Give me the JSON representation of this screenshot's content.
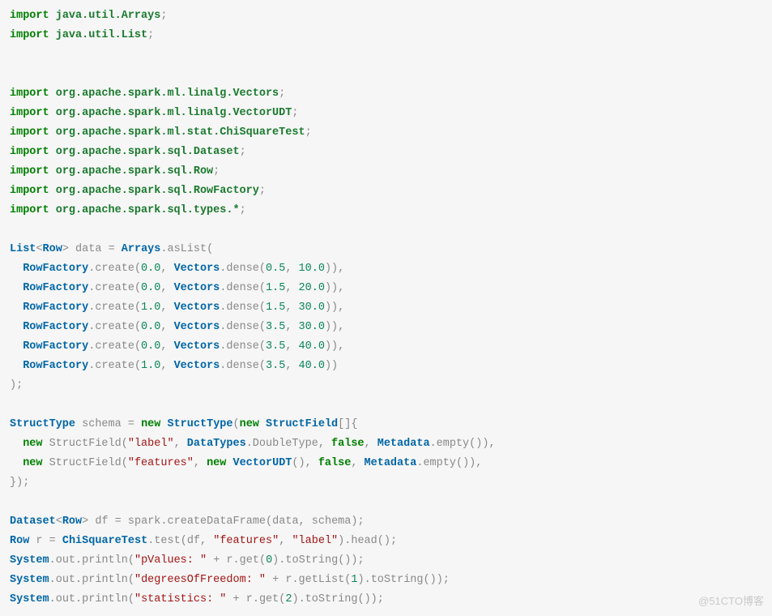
{
  "watermark": "@51CTO博客",
  "imports": [
    "java.util.Arrays",
    "java.util.List",
    "",
    "org.apache.spark.ml.linalg.Vectors",
    "org.apache.spark.ml.linalg.VectorUDT",
    "org.apache.spark.ml.stat.ChiSquareTest",
    "org.apache.spark.sql.Dataset",
    "org.apache.spark.sql.Row",
    "org.apache.spark.sql.RowFactory",
    "org.apache.spark.sql.types.*"
  ],
  "data_decl": {
    "type_outer": "List",
    "type_inner": "Row",
    "name": "data",
    "factory_class": "Arrays",
    "factory_method": "asList",
    "row_class": "RowFactory",
    "row_method": "create",
    "vec_class": "Vectors",
    "vec_method": "dense",
    "rows": [
      {
        "label": "0.0",
        "a": "0.5",
        "b": "10.0"
      },
      {
        "label": "0.0",
        "a": "1.5",
        "b": "20.0"
      },
      {
        "label": "1.0",
        "a": "1.5",
        "b": "30.0"
      },
      {
        "label": "0.0",
        "a": "3.5",
        "b": "30.0"
      },
      {
        "label": "0.0",
        "a": "3.5",
        "b": "40.0"
      },
      {
        "label": "1.0",
        "a": "3.5",
        "b": "40.0"
      }
    ]
  },
  "schema_decl": {
    "type": "StructType",
    "name": "schema",
    "field_type": "StructField",
    "fields": [
      {
        "name_str": "\"label\"",
        "dtype": "DataTypes",
        "dtype_member": "DoubleType",
        "nullable": "false",
        "meta_class": "Metadata",
        "meta_call": "empty"
      },
      {
        "name_str": "\"features\"",
        "udt": "VectorUDT",
        "nullable": "false",
        "meta_class": "Metadata",
        "meta_call": "empty"
      }
    ]
  },
  "tail": {
    "ds_type": "Dataset",
    "ds_inner": "Row",
    "ds_name": "df",
    "spark": "spark",
    "create": "createDataFrame",
    "data_arg": "data",
    "schema_arg": "schema",
    "row_type": "Row",
    "row_name": "r",
    "test_class": "ChiSquareTest",
    "test_method": "test",
    "feat_str": "\"features\"",
    "label_str": "\"label\"",
    "head": "head",
    "sys": "System",
    "out": "out",
    "println": "println",
    "line1_str": "\"pValues: \"",
    "line1_idx": "0",
    "line2_str": "\"degreesOfFreedom: \"",
    "line2_idx": "1",
    "line3_str": "\"statistics: \"",
    "line3_idx": "2",
    "get": "get",
    "getList": "getList",
    "toString": "toString"
  }
}
